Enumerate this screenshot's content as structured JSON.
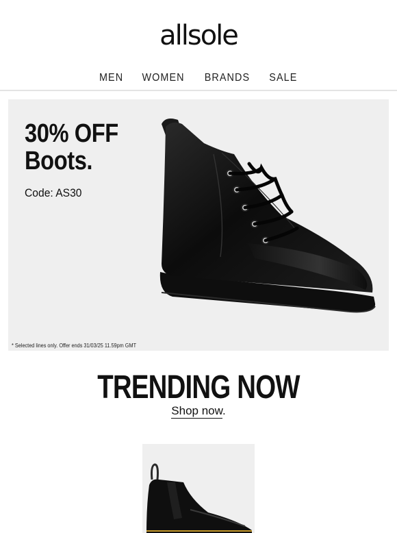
{
  "brand": {
    "logo_text": "allsole"
  },
  "nav": {
    "items": [
      {
        "label": "MEN"
      },
      {
        "label": "WOMEN"
      },
      {
        "label": "BRANDS"
      },
      {
        "label": "SALE"
      }
    ]
  },
  "hero": {
    "headline_line1": "30% OFF",
    "headline_line2": "Boots.",
    "code": "Code: AS30",
    "disclaimer": "* Selected lines only. Offer ends 31/03/25 11.59pm GMT",
    "background_color": "#efefef"
  },
  "trending": {
    "title": "TRENDING NOW",
    "shop_now": "Shop now",
    "shop_now_suffix": "."
  }
}
